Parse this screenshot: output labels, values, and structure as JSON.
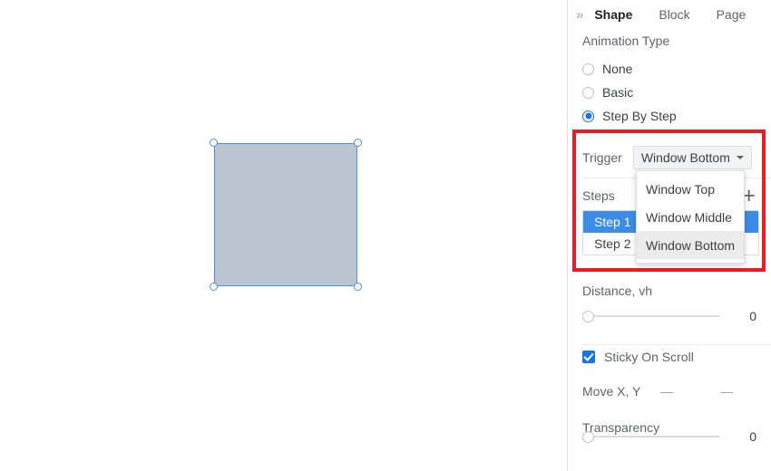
{
  "panel": {
    "collapse_icon": "»",
    "tabs": [
      {
        "label": "Shape",
        "active": true
      },
      {
        "label": "Block",
        "active": false
      },
      {
        "label": "Page",
        "active": false
      }
    ],
    "animation_type": {
      "label": "Animation Type",
      "options": [
        {
          "label": "None",
          "selected": false
        },
        {
          "label": "Basic",
          "selected": false
        },
        {
          "label": "Step By Step",
          "selected": true
        }
      ]
    },
    "trigger": {
      "label": "Trigger",
      "value": "Window Bottom",
      "menu_open": true,
      "options": [
        {
          "label": "Window Top",
          "hovered": false
        },
        {
          "label": "Window Middle",
          "hovered": false
        },
        {
          "label": "Window Bottom",
          "hovered": true
        }
      ]
    },
    "steps": {
      "label": "Steps",
      "add_button": "+",
      "items": [
        {
          "label": "Step 1",
          "selected": true
        },
        {
          "label": "Step 2",
          "selected": false
        }
      ]
    },
    "distance": {
      "label": "Distance, vh",
      "value": "0"
    },
    "sticky_on_scroll": {
      "label": "Sticky On Scroll",
      "checked": true
    },
    "move_xy": {
      "label": "Move X, Y",
      "x_value": "—",
      "y_value": "—"
    },
    "transparency": {
      "label": "Transparency",
      "value": "0"
    }
  },
  "canvas": {
    "shape_name": "selected-rectangle",
    "fill_color": "#bcc4d0",
    "outline_color": "#4a90e2"
  },
  "annotation": {
    "highlight_color": "#ec1c24"
  }
}
